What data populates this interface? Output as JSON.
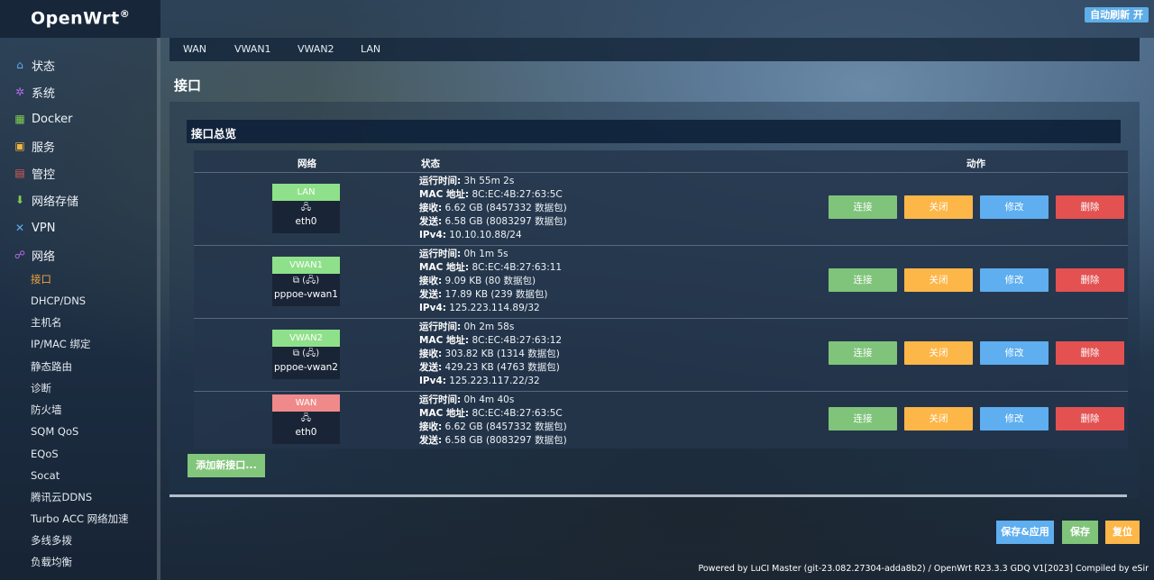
{
  "header": {
    "logo": "OpenWrt",
    "logo_mark": "®",
    "auto_refresh_label": "自动刷新 开"
  },
  "sidebar": {
    "items": [
      {
        "label": "状态",
        "icon": "home-icon"
      },
      {
        "label": "系统",
        "icon": "gear-icon"
      },
      {
        "label": "Docker",
        "icon": "grid-icon"
      },
      {
        "label": "服务",
        "icon": "monitor-icon"
      },
      {
        "label": "管控",
        "icon": "control-icon"
      },
      {
        "label": "网络存储",
        "icon": "download-icon"
      },
      {
        "label": "VPN",
        "icon": "shuffle-icon"
      },
      {
        "label": "网络",
        "icon": "network-icon"
      }
    ],
    "subitems": [
      "接口",
      "DHCP/DNS",
      "主机名",
      "IP/MAC 绑定",
      "静态路由",
      "诊断",
      "防火墙",
      "SQM QoS",
      "EQoS",
      "Socat",
      "腾讯云DDNS",
      "Turbo ACC 网络加速",
      "多线多拨",
      "负载均衡"
    ],
    "active_subitem": "接口"
  },
  "tabs": [
    "WAN",
    "VWAN1",
    "VWAN2",
    "LAN"
  ],
  "page_title": "接口",
  "section_title": "接口总览",
  "table": {
    "headers": {
      "network": "网络",
      "status": "状态",
      "actions": "动作"
    },
    "status_labels": {
      "uptime": "运行时间:",
      "mac": "MAC 地址:",
      "rx": "接收:",
      "tx": "发送:",
      "ipv4": "IPv4:"
    },
    "action_labels": {
      "connect": "连接",
      "stop": "关闭",
      "edit": "修改",
      "delete": "删除"
    },
    "rows": [
      {
        "name": "LAN",
        "color": "#8fe08a",
        "icons": "🖧",
        "device": "eth0",
        "uptime": "3h 55m 2s",
        "mac": "8C:EC:4B:27:63:5C",
        "rx": "6.62 GB (8457332 数据包)",
        "tx": "6.58 GB (8083297 数据包)",
        "ipv4": "10.10.10.88/24"
      },
      {
        "name": "VWAN1",
        "color": "#8fe08a",
        "icons": "⧉ (🖧)",
        "device": "pppoe-vwan1",
        "uptime": "0h 1m 5s",
        "mac": "8C:EC:4B:27:63:11",
        "rx": "9.09 KB (80 数据包)",
        "tx": "17.89 KB (239 数据包)",
        "ipv4": "125.223.114.89/32"
      },
      {
        "name": "VWAN2",
        "color": "#8fe08a",
        "icons": "⧉ (🖧)",
        "device": "pppoe-vwan2",
        "uptime": "0h 2m 58s",
        "mac": "8C:EC:4B:27:63:12",
        "rx": "303.82 KB (1314 数据包)",
        "tx": "429.23 KB (4763 数据包)",
        "ipv4": "125.223.117.22/32"
      },
      {
        "name": "WAN",
        "color": "#f08a8a",
        "icons": "🖧",
        "device": "eth0",
        "uptime": "0h 4m 40s",
        "mac": "8C:EC:4B:27:63:5C",
        "rx": "6.62 GB (8457332 数据包)",
        "tx": "6.58 GB (8083297 数据包)",
        "ipv4": null
      }
    ]
  },
  "add_interface_label": "添加新接口...",
  "footer_buttons": {
    "save_apply": "保存&应用",
    "save": "保存",
    "reset": "复位"
  },
  "footer_text": "Powered by LuCI Master (git-23.082.27304-adda8b2) / OpenWrt R23.3.3 GDQ V1[2023] Compiled by eSir"
}
